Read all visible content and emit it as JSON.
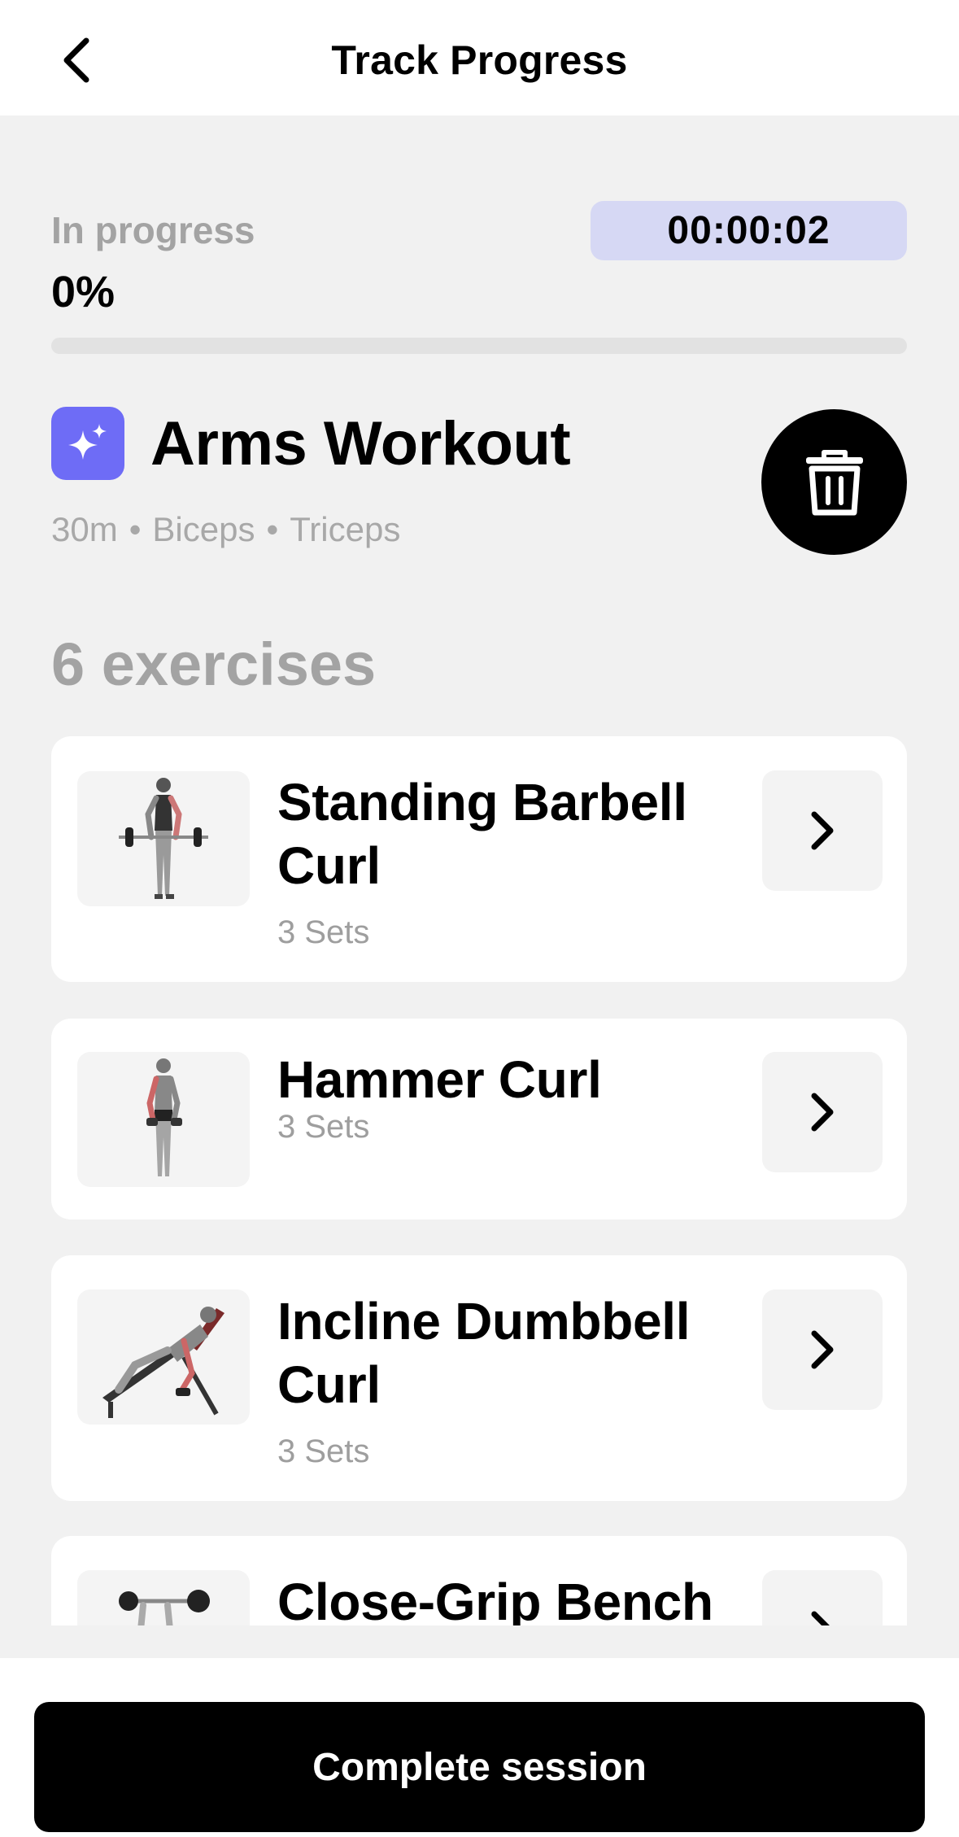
{
  "header": {
    "title": "Track Progress",
    "back_icon": "chevron-left-icon"
  },
  "session": {
    "status_label": "In progress",
    "percent_label": "0%",
    "progress_value": 0,
    "timer": "00:00:02",
    "timer_bg": "#d6d8f4"
  },
  "workout": {
    "icon": "sparkles-icon",
    "icon_bg": "#6e6cf6",
    "title": "Arms Workout",
    "duration": "30m",
    "muscles": [
      "Biceps",
      "Triceps"
    ],
    "separator": "•",
    "delete_icon": "trash-icon"
  },
  "exercises": {
    "count_label": "6 exercises",
    "items": [
      {
        "name": "Standing Barbell Curl",
        "sets": "3 Sets"
      },
      {
        "name": "Hammer Curl",
        "sets": "3 Sets"
      },
      {
        "name": "Incline Dumbbell Curl",
        "sets": "3 Sets"
      },
      {
        "name": "Close-Grip Bench",
        "sets": ""
      }
    ],
    "chevron_icon": "chevron-right-icon"
  },
  "footer": {
    "complete_label": "Complete session"
  }
}
